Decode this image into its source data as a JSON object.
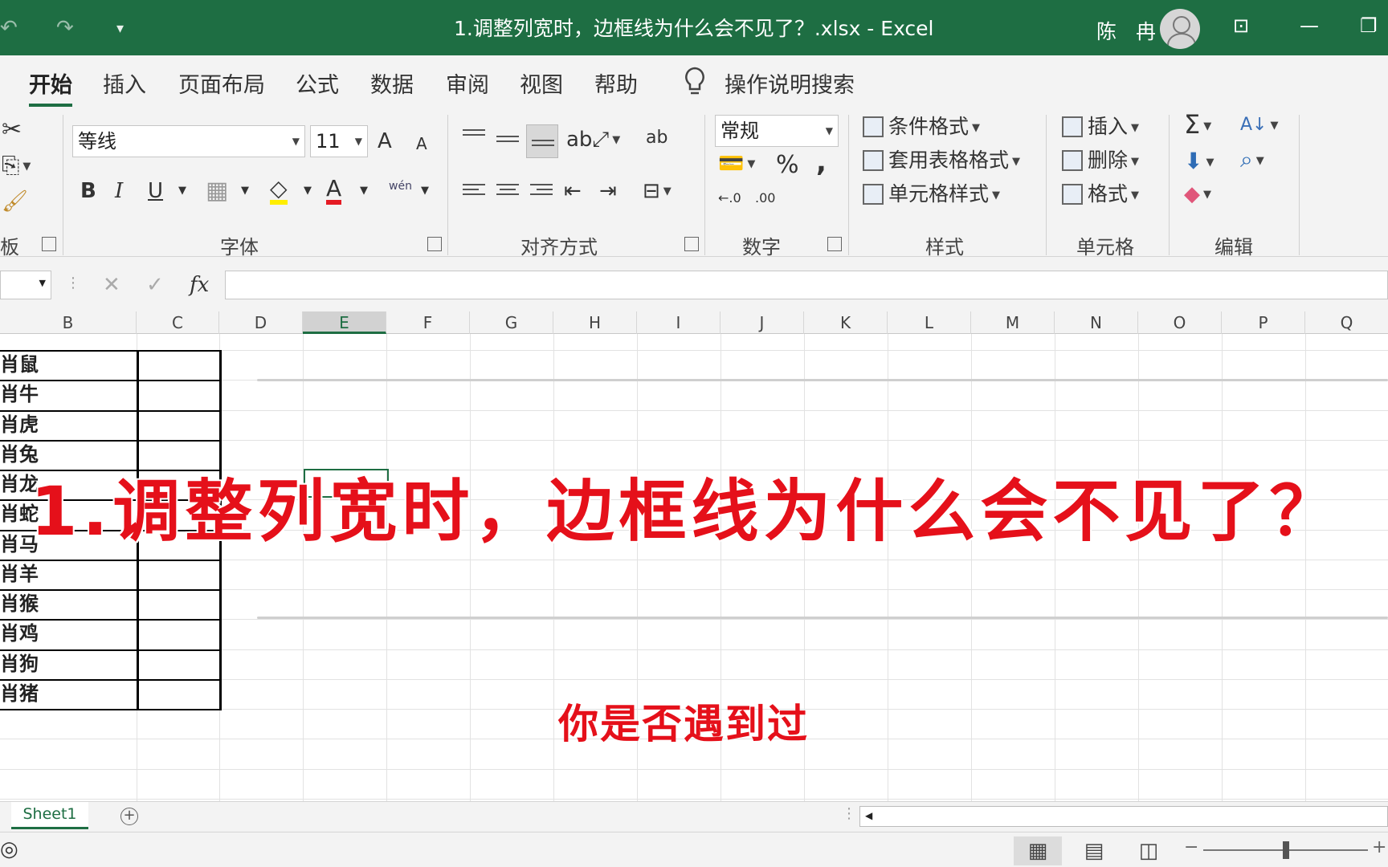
{
  "titlebar": {
    "title": "1.调整列宽时，边框线为什么会不见了？.xlsx  -  Excel",
    "user": "陈 冉",
    "undo_icon": "↶",
    "redo_icon": "↷",
    "qat_icon": "▾"
  },
  "tabs": [
    "开始",
    "插入",
    "页面布局",
    "公式",
    "数据",
    "审阅",
    "视图",
    "帮助"
  ],
  "search": {
    "label": "操作说明搜索"
  },
  "ribbon": {
    "clipboard_label": "板",
    "font": {
      "label": "字体",
      "name": "等线",
      "size": "11",
      "grow": "A",
      "shrink": "A",
      "bold": "B",
      "italic": "I",
      "underline": "U",
      "font_color": "A",
      "phonetic": "wén"
    },
    "alignment": {
      "label": "对齐方式",
      "wrap": "ab"
    },
    "number": {
      "label": "数字",
      "format": "常规",
      "percent": "%",
      "comma": ",",
      "inc_decimal": "←.0",
      "dec_decimal": ".00"
    },
    "styles": {
      "label": "样式",
      "conditional": "条件格式",
      "table": "套用表格格式",
      "cell_styles": "单元格样式"
    },
    "cells": {
      "label": "单元格",
      "insert": "插入",
      "delete": "删除",
      "format": "格式"
    },
    "editing": {
      "label": "编辑",
      "sum": "Σ",
      "sort": "A↓"
    }
  },
  "formula_bar": {
    "fx": "fx",
    "cancel": "✕",
    "enter": "✓",
    "value": ""
  },
  "columns": [
    "B",
    "C",
    "D",
    "E",
    "F",
    "G",
    "H",
    "I",
    "J",
    "K",
    "L",
    "M",
    "N",
    "O",
    "P",
    "Q"
  ],
  "selected_column": "E",
  "cells_b": [
    "肖鼠",
    "肖牛",
    "肖虎",
    "肖兔",
    "肖龙",
    "肖蛇",
    "肖马",
    "肖羊",
    "肖猴",
    "肖鸡",
    "肖狗",
    "肖猪"
  ],
  "overlay": {
    "headline": "1.调整列宽时，边框线为什么会不见了？",
    "subtitle": "你是否遇到过"
  },
  "sheets": [
    "Sheet1"
  ],
  "add_sheet": "+",
  "colors": {
    "excel_green": "#1e6e43",
    "overlay_red": "#e5101a"
  }
}
